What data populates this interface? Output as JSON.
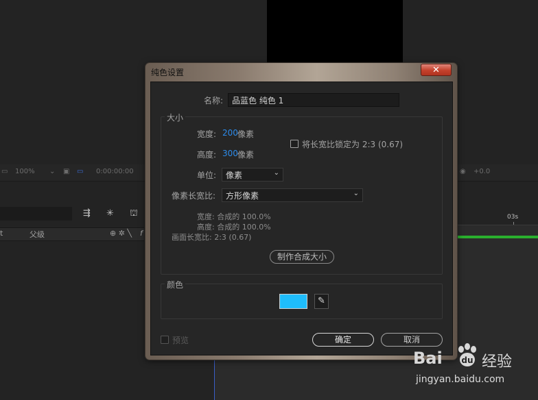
{
  "background": {
    "toolbar": {
      "zoom": "100%",
      "timecode": "0:00:00:00",
      "offset": "+0.0"
    },
    "layers_panel": {
      "col_left": "t",
      "col_parent": "父级",
      "col_switch": "f"
    },
    "timeline": {
      "ruler_label": "03s"
    }
  },
  "dialog": {
    "title": "纯色设置",
    "close_glyph": "✕",
    "name_label": "名称:",
    "name_value": "品蓝色 纯色 1",
    "size_group": {
      "title": "大小",
      "width_label": "宽度:",
      "width_value": "200",
      "width_unit": "像素",
      "height_label": "高度:",
      "height_value": "300",
      "height_unit": "像素",
      "lock_ratio_label": "将长宽比锁定为 2:3 (0.67)",
      "lock_ratio_checked": false,
      "unit_label": "单位:",
      "unit_value": "像素",
      "par_label": "像素长宽比:",
      "par_value": "方形像素",
      "info_width": "宽度: 合成的 100.0%",
      "info_height": "高度: 合成的 100.0%",
      "info_frame_aspect": "画面长宽比: 2:3 (0.67)",
      "make_comp_size_button": "制作合成大小"
    },
    "color_group": {
      "title": "颜色",
      "swatch_color": "#1fbdfb"
    },
    "preview_label": "预览",
    "preview_checked": false,
    "ok_button": "确定",
    "cancel_button": "取消"
  },
  "watermark": {
    "brand_left": "Bai",
    "brand_right": "经验",
    "url": "jingyan.baidu.com"
  }
}
